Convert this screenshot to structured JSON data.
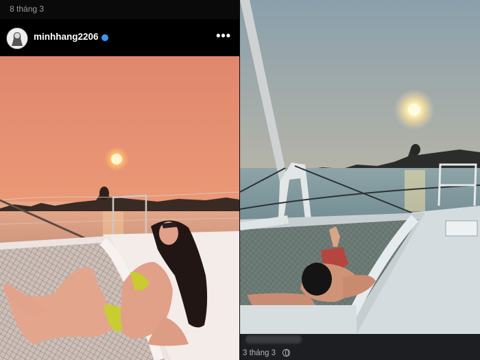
{
  "left_post": {
    "date": "8 tháng 3",
    "username": "minhhang2206",
    "more_label": "•••",
    "verified_icon": "verified-badge-icon",
    "avatar_icon": "avatar-icon",
    "photo": "sunset on catamaran bow with woman on net"
  },
  "right_post": {
    "date": "3 tháng 3",
    "privacy_icon": "globe-icon",
    "photo": "sunset on catamaran bow with man lying on deck"
  },
  "colors": {
    "left_sky": "#e49070",
    "right_sky": "#9ba6ae",
    "verified": "#3897f0"
  }
}
